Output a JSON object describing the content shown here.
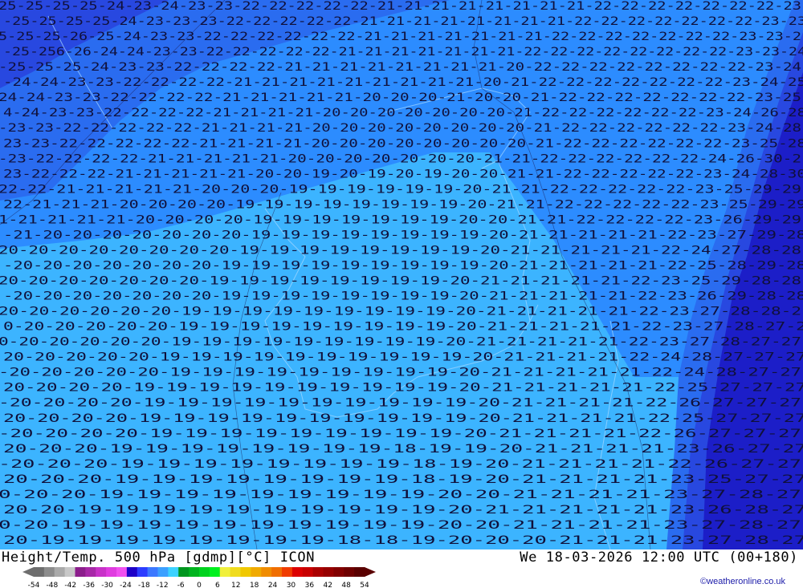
{
  "map": {
    "parameter": "Height/Temp. 500 hPa [gdmp][°C] ICON",
    "valid_time": "We 18-03-2026 12:00 UTC (00+180)",
    "credit": "©weatheronline.co.uk",
    "contour_label_rows": [
      "25-25-25-25-24-23-24-23-23-22-22-22-22-22-21-21-21-21-21-21-21-21-22-22-22-22-22-22-22-23",
      "-25-25-25-25-24-23-23-23-22-22-22-22-22-21-21-21-21-21-21-21-21-22-22-22-22-22-22-22-23-23",
      "5-25-25-26-25-24-23-23-22-22-22-22-22-22-21-21-21-21-21-21-21-22-22-22-22-22-22-22-23-23-2",
      "-25-256-26-24-24-23-23-22-22-22-22-22-21-21-21-21-21-21-21-22-22-22-22-22-22-22-22-23-23-24",
      "-25-25-25-24-23-23-22-22-22-22-21-21-21-21-21-21-21-21-20-22-22-22-22-22-22-22-22-23-24",
      "-24-24-23-23-22-22-22-22-21-21-21-21-21-21-21-21-21-20-21-22-22-22-22-22-22-22-23-24-25",
      "24-24-23-23-22-22-22-22-21-21-21-21-21-20-20-20-21-20-20-21-22-22-22-22-22-22-22-23-25",
      "4-24-23-23-22-22-22-22-21-21-21-21-20-20-20-20-20-20-20-21-22-22-22-22-22-22-23-24-26-28",
      "-23-23-22-22-22-22-22-21-21-21-21-20-20-20-20-20-20-20-20-21-22-22-22-22-22-22-23-24-28",
      "23-23-22-22-22-22-22-21-21-21-21-20-20-20-20-20-20-20-20-21-22-22-22-22-22-22-23-25-28",
      "-23-22-22-22-22-21-21-21-21-21-20-20-20-20-20-20-20-21-21-22-22-22-22-22-22-24-26-30-2",
      "23-22-22-22-21-21-21-21-21-20-20-19-20-19-20-19-20-20-21-21-22-22-22-22-22-23-24-28-30",
      "22-22-21-21-21-21-21-20-20-20-19-19-19-19-19-19-20-21-21-22-22-22-22-22-23-25-29-29",
      "22-21-21-21-20-20-20-20-19-19-19-19-19-19-19-19-20-21-21-22-22-22-22-22-23-25-29-29",
      "1-21-21-21-21-20-20-20-20-19-19-19-19-19-19-19-20-20-21-21-22-22-22-22-23-26-29-29",
      "-21-20-20-20-20-20-20-20-19-19-19-19-19-19-19-19-20-21-21-21-21-21-22-23-27-29-28",
      "20-20-20-20-20-20-20-20-19-19-19-19-19-19-19-19-20-21-21-21-21-21-22-24-27-28-28",
      "-20-20-20-20-20-20-20-19-19-19-19-19-19-19-19-19-20-21-21-21-21-21-22-25-28-29-28",
      "20-20-20-20-20-20-20-19-19-19-19-19-19-19-19-20-21-21-21-21-21-22-23-25-29-28-28",
      "-20-20-20-20-20-20-20-19-19-19-19-19-19-19-19-20-21-21-21-21-21-22-23-26-29-28-28",
      "20-20-20-20-20-20-19-19-19-19-19-19-19-19-19-20-21-21-21-21-21-22-23-27-28-28-2",
      "0-20-20-20-20-20-19-19-19-19-19-19-19-19-19-20-21-21-21-21-21-22-23-27-28-27-2",
      "0-20-20-20-20-20-19-19-19-19-19-19-19-19-19-20-21-21-21-21-21-22-23-27-28-27-27",
      "20-20-20-20-20-19-19-19-19-19-19-19-19-19-19-20-21-21-21-21-22-24-28-27-27-27",
      "-20-20-20-20-20-19-19-19-19-19-19-19-19-19-20-21-21-21-21-21-22-24-28-27-27",
      "20-20-20-20-19-19-19-19-19-19-19-19-19-19-20-21-21-21-21-21-22-25-27-27-27",
      "-20-20-20-20-19-19-19-19-19-19-19-19-19-19-20-21-21-21-21-22-26-27-27-27",
      "20-20-20-20-19-19-19-19-19-19-19-19-19-19-20-21-21-21-21-22-25-27-27-27",
      "-20-20-20-20-19-19-19-19-19-19-19-19-19-20-21-21-21-21-22-26-27-27-27",
      "20-20-20-19-19-19-19-19-19-19-19-18-19-19-20-21-21-21-21-23-26-27-27",
      "-20-20-20-19-19-19-19-19-19-19-19-18-19-20-21-21-21-21-22-26-27-27",
      "20-20-20-19-19-19-19-19-19-19-19-18-19-20-21-21-21-21-23-25-27-27",
      "0-20-20-19-19-19-19-19-19-19-19-19-20-20-21-21-21-21-23-27-28-27",
      "20-20-19-19-19-19-19-19-19-19-19-19-20-21-21-21-21-21-23-26-28-27",
      "0-20-19-19-19-19-19-19-19-19-19-19-20-20-21-21-21-21-23-27-28-27",
      "20-19-19-19-19-19-19-19-19-18-18-19-20-20-20-21-21-21-23-27-28-27"
    ]
  },
  "colorbar": {
    "labels": [
      "-54",
      "-48",
      "-42",
      "-36",
      "-30",
      "-24",
      "-18",
      "-12",
      "-6",
      "0",
      "6",
      "12",
      "18",
      "24",
      "30",
      "36",
      "42",
      "48",
      "54"
    ],
    "colors": [
      "#6e6e6e",
      "#8c8c8c",
      "#aaaaaa",
      "#c8c8c8",
      "#8c1e8c",
      "#a828a8",
      "#c832c8",
      "#e03ce0",
      "#f050f0",
      "#1e00c8",
      "#2c3cff",
      "#3c78ff",
      "#3ca0ff",
      "#3cd2ff",
      "#00961e",
      "#00b41e",
      "#00d21e",
      "#00f01e",
      "#f0f03c",
      "#f0dc1e",
      "#f0c800",
      "#f0aa00",
      "#f08c00",
      "#f06e00",
      "#f03c00",
      "#dc0000",
      "#c80000",
      "#aa0000",
      "#960000",
      "#820000",
      "#6e0000",
      "#5a0000"
    ]
  }
}
